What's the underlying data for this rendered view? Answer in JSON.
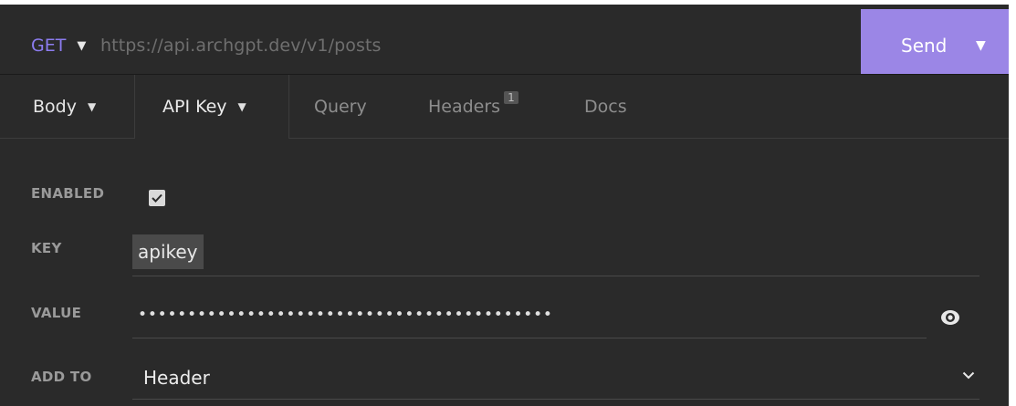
{
  "request": {
    "method": "GET",
    "url": "https://api.archgpt.dev/v1/posts",
    "send_label": "Send"
  },
  "tabs": {
    "body": "Body",
    "api_key": "API Key",
    "query": "Query",
    "headers": "Headers",
    "headers_count": "1",
    "docs": "Docs"
  },
  "form": {
    "enabled_label": "ENABLED",
    "enabled": true,
    "key_label": "KEY",
    "key_value": "apikey",
    "value_label": "VALUE",
    "value_masked": "••••••••••••••••••••••••••••••••••••••••••",
    "add_to_label": "ADD TO",
    "add_to_value": "Header"
  },
  "icons": {
    "method_caret": "caret-down-icon",
    "send_caret": "caret-down-icon",
    "checkbox": "check-icon",
    "reveal": "eye-icon",
    "select": "chevron-down-icon"
  },
  "colors": {
    "accent": "#9b86e6",
    "method": "#8c7cf0",
    "background": "#2a2a2a"
  }
}
